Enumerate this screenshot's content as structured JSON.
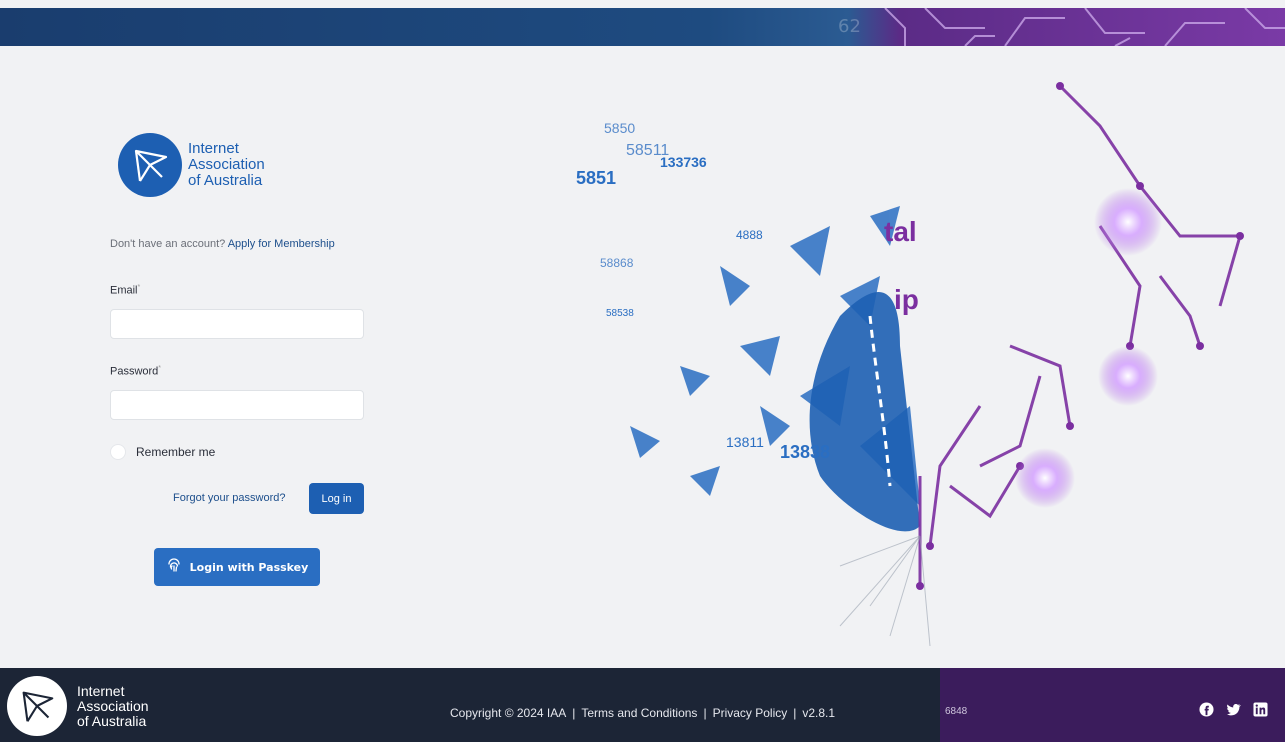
{
  "banner": {
    "number": "62"
  },
  "brand": {
    "line1": "Internet",
    "line2": "Association",
    "line3": "of Australia"
  },
  "signup": {
    "prompt": "Don't have an account?",
    "link": "Apply for Membership"
  },
  "form": {
    "email_label": "Email",
    "email_required": "*",
    "email_value": "",
    "password_label": "Password",
    "password_required": "*",
    "password_value": "",
    "remember_label": "Remember me",
    "remember_checked": false,
    "forgot_label": "Forgot your password?",
    "login_label": "Log in",
    "passkey_label": "Login with Passkey"
  },
  "hero": {
    "text_1": "tal",
    "text_2": "ip",
    "numbers": [
      "5851",
      "133736",
      "58511",
      "13838",
      "13811",
      "58538",
      "58868",
      "4888",
      "5850"
    ]
  },
  "footer": {
    "copyright": "Copyright © 2024 IAA",
    "terms": "Terms and Conditions",
    "privacy": "Privacy Policy",
    "version": "v2.8.1",
    "separator": "|",
    "number": "6848",
    "social": [
      "facebook-icon",
      "twitter-icon",
      "linkedin-icon"
    ]
  },
  "colors": {
    "primary": "#1d5fb2",
    "footer_dark": "#1c2536",
    "footer_purple": "#3b1c5c",
    "accent_purple": "#7b2fa0"
  }
}
